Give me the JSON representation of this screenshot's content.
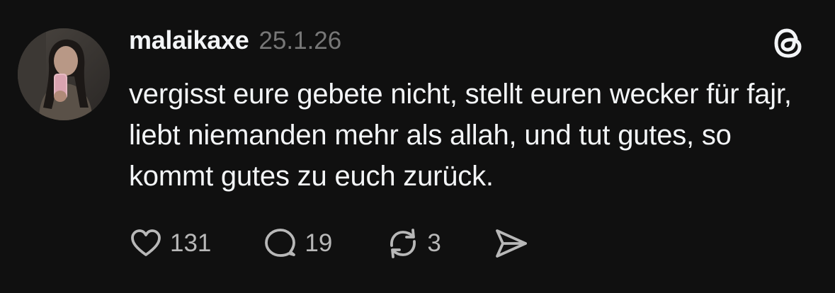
{
  "post": {
    "username": "malaikaxe",
    "date": "25.1.26",
    "text": "vergisst eure gebete nicht, stellt euren wecker für fajr, liebt niemanden mehr als allah, und tut gutes, so kommt gutes zu euch zurück.",
    "likes": "131",
    "replies": "19",
    "reposts": "3"
  },
  "icons": {
    "app_logo": "threads-logo-icon",
    "like": "heart-icon",
    "reply": "speech-bubble-icon",
    "repost": "repost-arrows-icon",
    "share": "send-paper-plane-icon"
  },
  "colors": {
    "background": "#101010",
    "primary_text": "#f3f5f7",
    "secondary_text": "#777777",
    "icon": "#b8b8b8"
  }
}
